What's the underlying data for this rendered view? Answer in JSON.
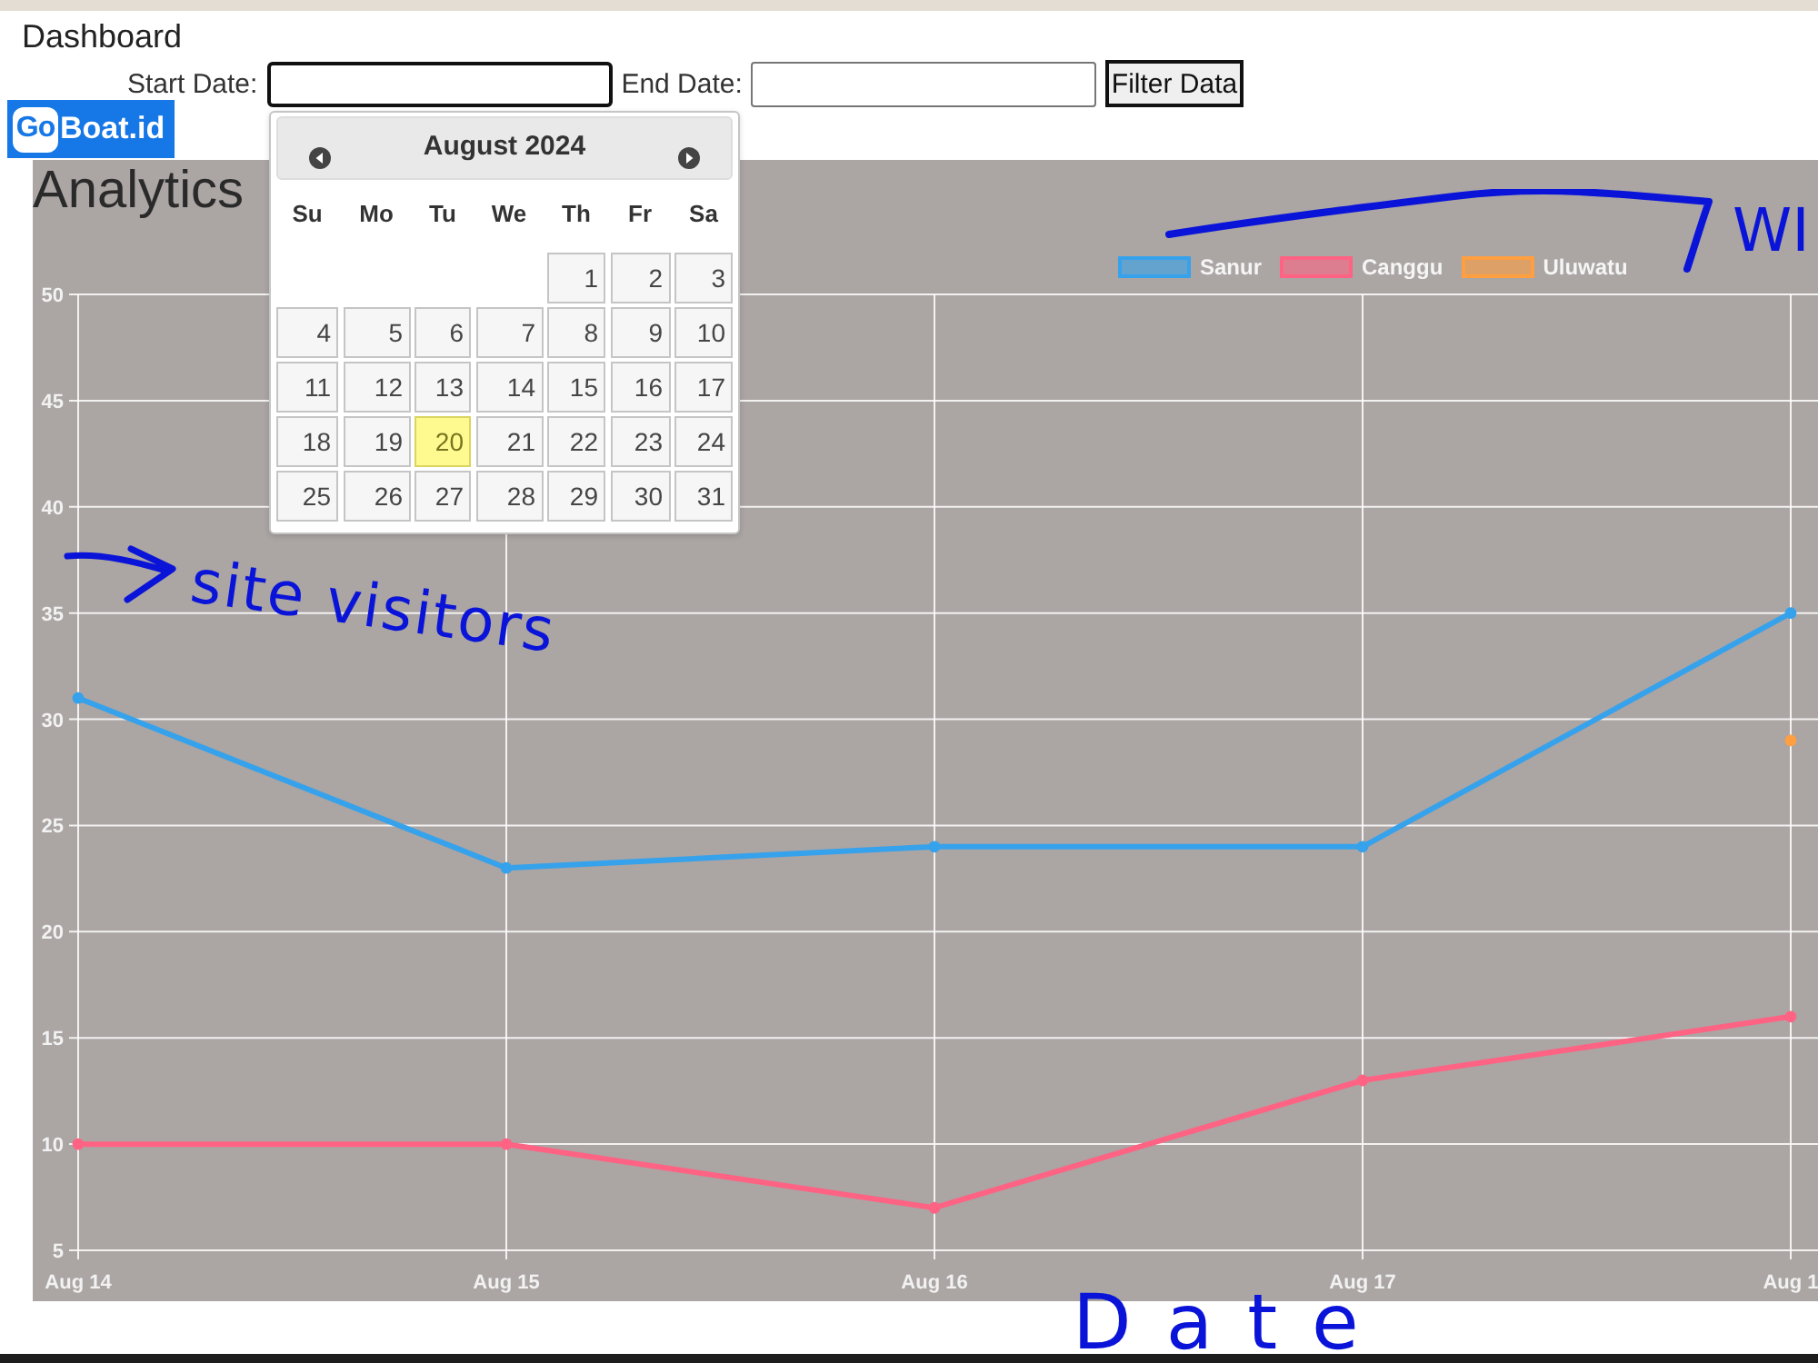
{
  "page": {
    "title": "Dashboard"
  },
  "logo": {
    "mark": "Go",
    "text": "Boat.id"
  },
  "filter": {
    "fields": [
      {
        "label": "Start Date:",
        "focused": true
      },
      {
        "label": "End Date:",
        "focused": false
      }
    ],
    "button": "Filter Data"
  },
  "datepicker": {
    "title": "August 2024",
    "weekdays": [
      "Su",
      "Mo",
      "Tu",
      "We",
      "Th",
      "Fr",
      "Sa"
    ],
    "weeks": [
      {
        "days": [
          {
            "label": "1",
            "today": false
          },
          {
            "label": "2",
            "today": false
          },
          {
            "label": "3",
            "today": false
          }
        ]
      },
      {
        "days": [
          {
            "label": "4",
            "today": false
          },
          {
            "label": "5",
            "today": false
          },
          {
            "label": "6",
            "today": false
          },
          {
            "label": "7",
            "today": false
          },
          {
            "label": "8",
            "today": false
          },
          {
            "label": "9",
            "today": false
          },
          {
            "label": "10",
            "today": false
          }
        ]
      },
      {
        "days": [
          {
            "label": "11",
            "today": false
          },
          {
            "label": "12",
            "today": false
          },
          {
            "label": "13",
            "today": false
          },
          {
            "label": "14",
            "today": false
          },
          {
            "label": "15",
            "today": false
          },
          {
            "label": "16",
            "today": false
          },
          {
            "label": "17",
            "today": false
          }
        ]
      },
      {
        "days": [
          {
            "label": "18",
            "today": false
          },
          {
            "label": "19",
            "today": false
          },
          {
            "label": "20",
            "today": true
          },
          {
            "label": "21",
            "today": false
          },
          {
            "label": "22",
            "today": false
          },
          {
            "label": "23",
            "today": false
          },
          {
            "label": "24",
            "today": false
          }
        ]
      },
      {
        "days": [
          {
            "label": "25",
            "today": false
          },
          {
            "label": "26",
            "today": false
          },
          {
            "label": "27",
            "today": false
          },
          {
            "label": "28",
            "today": false
          },
          {
            "label": "29",
            "today": false
          },
          {
            "label": "30",
            "today": false
          },
          {
            "label": "31",
            "today": false
          }
        ]
      }
    ]
  },
  "analytics": {
    "title": "Analytics",
    "chart_data": {
      "type": "line",
      "categories": [
        "Aug 14",
        "Aug 15",
        "Aug 16",
        "Aug 17",
        "Aug 1"
      ],
      "series": [
        {
          "name": "Sanur",
          "color": "#36a2eb",
          "marker": "circle",
          "values": [
            31,
            23,
            24,
            24,
            35
          ]
        },
        {
          "name": "Canggu",
          "color": "#ff6384",
          "marker": "circle",
          "values": [
            10,
            10,
            7,
            13,
            16
          ]
        },
        {
          "name": "Uluwatu",
          "color": "#ff9f40",
          "marker": "circle",
          "values": [
            null,
            null,
            null,
            null,
            29
          ]
        }
      ],
      "ylim": [
        5,
        50
      ],
      "yticks": [
        {
          "value": 5,
          "label": "5"
        },
        {
          "value": 10,
          "label": "10"
        },
        {
          "value": 15,
          "label": "15"
        },
        {
          "value": 20,
          "label": "20"
        },
        {
          "value": 25,
          "label": "25"
        },
        {
          "value": 30,
          "label": "30"
        },
        {
          "value": 35,
          "label": "35"
        },
        {
          "value": 40,
          "label": "40"
        },
        {
          "value": 45,
          "label": "45"
        },
        {
          "value": 50,
          "label": "50"
        }
      ],
      "grid": true,
      "legend": "top"
    }
  },
  "annotations": [
    {
      "kind": "arrow",
      "text": "site visitors"
    },
    {
      "kind": "curve",
      "text": "WI"
    },
    {
      "kind": "plain",
      "text": "Date"
    }
  ]
}
